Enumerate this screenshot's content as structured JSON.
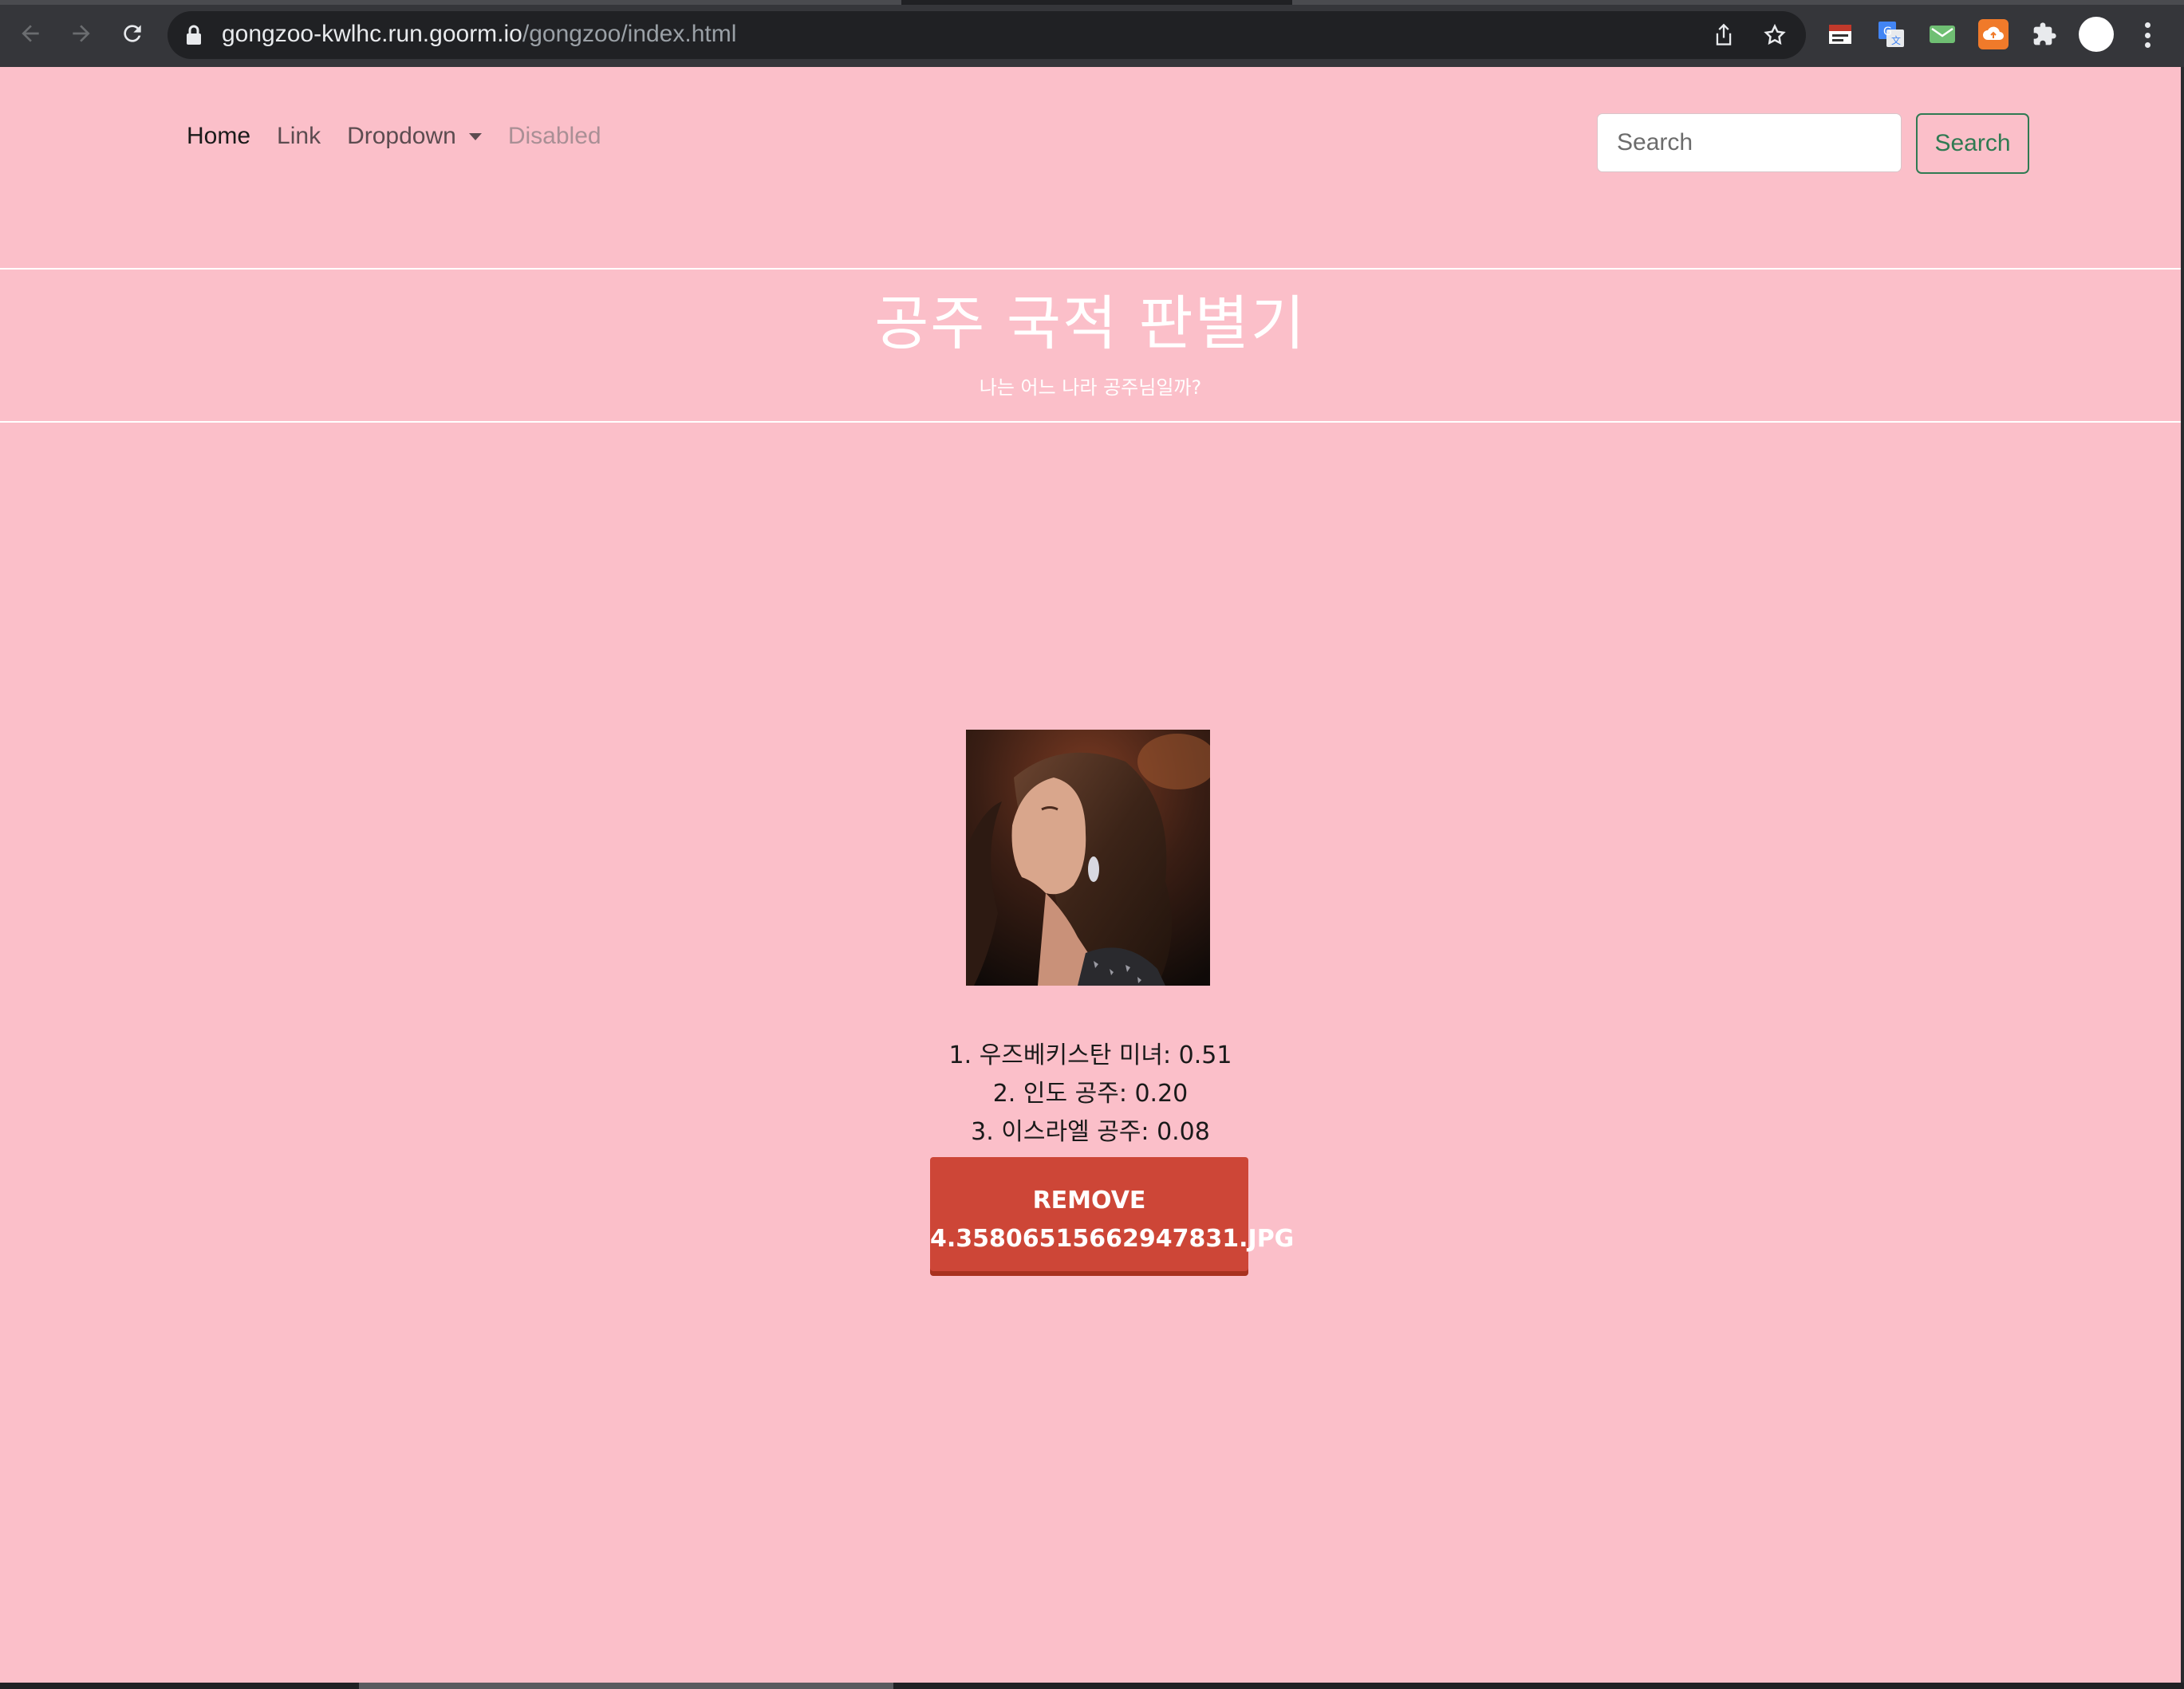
{
  "browser": {
    "url_host": "gongzoo-kwlhc.run.goorm.io",
    "url_path": "/gongzoo/index.html",
    "icons": [
      "back-icon",
      "forward-icon",
      "reload-icon",
      "lock-icon",
      "share-icon",
      "bookmark-star-icon",
      "extension-icon",
      "translate-icon",
      "mail-check-icon",
      "cloud-upload-icon",
      "puzzle-icon",
      "profile-avatar",
      "menu-kebab-icon"
    ]
  },
  "navbar": {
    "links": [
      "Home",
      "Link",
      "Dropdown",
      "Disabled"
    ],
    "search_placeholder": "Search",
    "search_button": "Search",
    "button_color": "#2f7a52"
  },
  "hero": {
    "title": "공주 국적 판별기",
    "subtitle": "나는 어느 나라 공주님일까?"
  },
  "results": [
    "1. 우즈베키스탄 미녀: 0.51",
    "2. 인도 공주: 0.20",
    "3. 이스라엘 공주: 0.08"
  ],
  "remove_button": {
    "line1": "REMOVE",
    "line2": "4.35806515662947831.JPG",
    "color": "#cd4637"
  },
  "theme": {
    "background": "#fbbfc9"
  }
}
